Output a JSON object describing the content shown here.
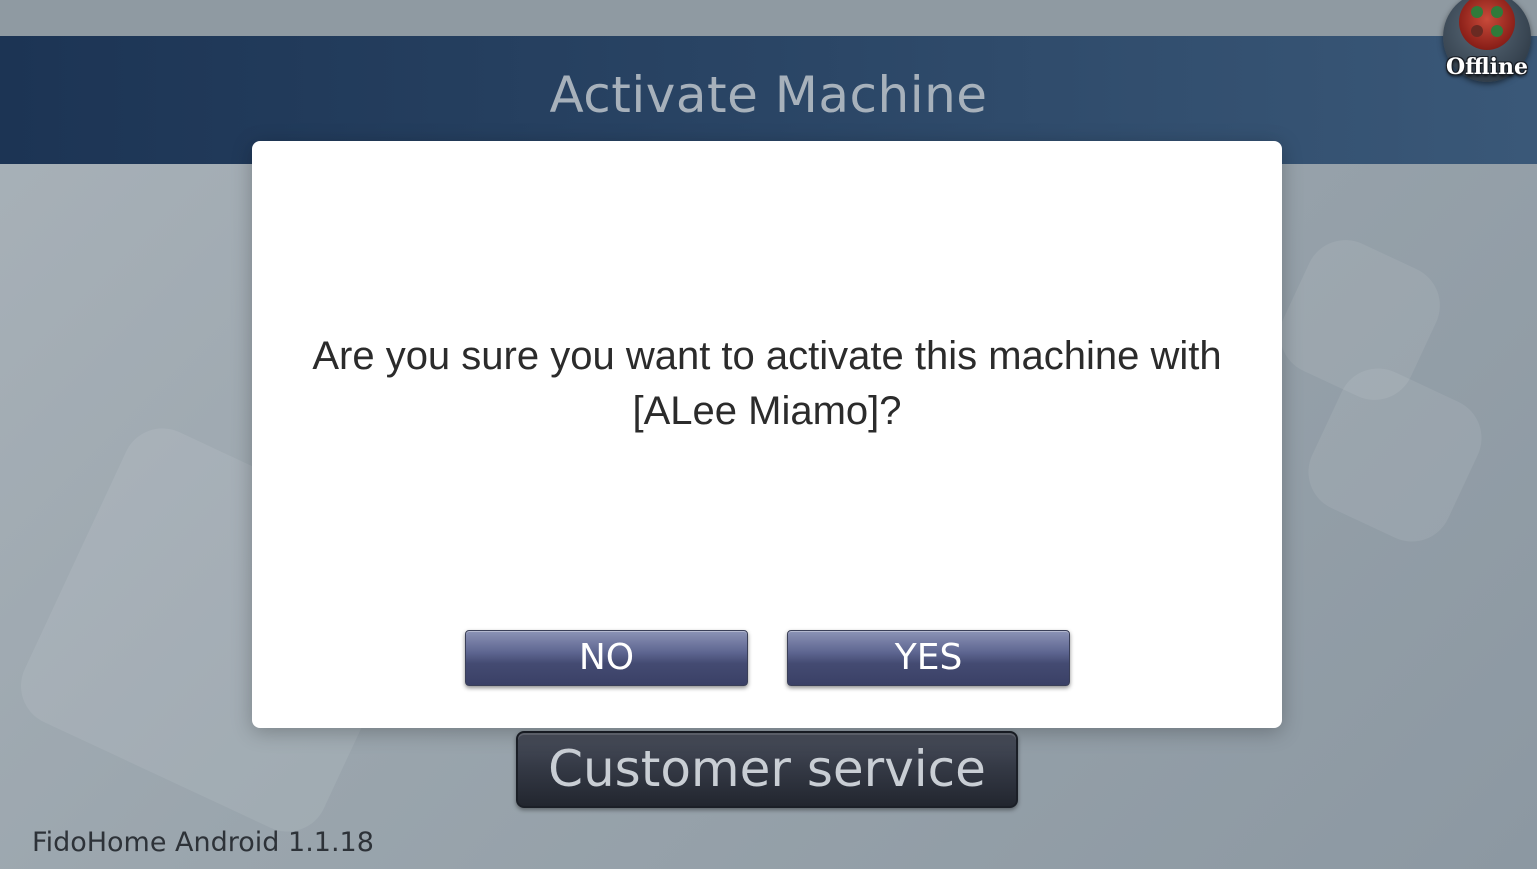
{
  "header": {
    "title": "Activate Machine"
  },
  "status": {
    "label": "Offline",
    "icon": "status-light-icon",
    "color": "#c84a3a"
  },
  "dialog": {
    "message": "Are you sure you want to activate this machine with [ALee Miamo]?",
    "no_label": "NO",
    "yes_label": "YES"
  },
  "footer": {
    "customer_service_label": "Customer service",
    "version": "FidoHome Android 1.1.18"
  },
  "colors": {
    "header": "#1c3454",
    "dialog_button": "#4a5278"
  }
}
